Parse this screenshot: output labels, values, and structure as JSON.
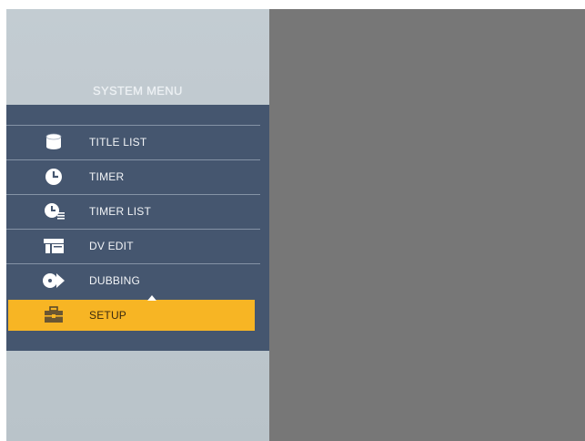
{
  "menu": {
    "title": "SYSTEM MENU",
    "items": [
      {
        "label": "TITLE LIST",
        "icon": "database-icon"
      },
      {
        "label": "TIMER",
        "icon": "clock-icon"
      },
      {
        "label": "TIMER LIST",
        "icon": "timer-list-icon"
      },
      {
        "label": "DV EDIT",
        "icon": "dv-edit-icon"
      },
      {
        "label": "DUBBING",
        "icon": "dubbing-icon"
      },
      {
        "label": "SETUP",
        "icon": "toolbox-icon",
        "selected": true
      }
    ]
  },
  "colors": {
    "menu_bg": "#45566f",
    "highlight": "#f7b524",
    "panel_bg": "#c3ccd2",
    "screen_bg": "#777777"
  }
}
